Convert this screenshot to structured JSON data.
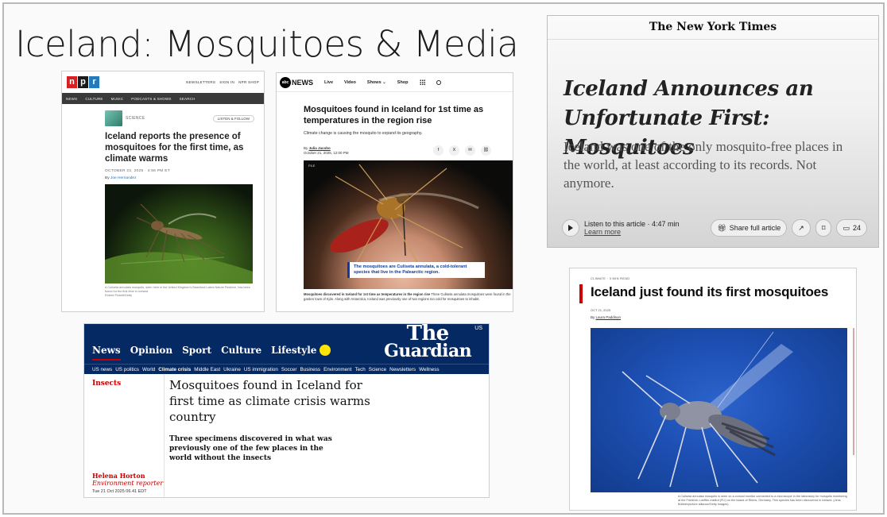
{
  "slide": {
    "title": "Iceland: Mosquitoes & Media"
  },
  "npr": {
    "logo": [
      "n",
      "p",
      "r"
    ],
    "util": [
      "NEWSLETTERS",
      "SIGN IN",
      "NPR SHOP"
    ],
    "nav": [
      "NEWS",
      "CULTURE",
      "MUSIC",
      "PODCASTS & SHOWS",
      "SEARCH"
    ],
    "section": "SCIENCE",
    "listen": "LISTEN & FOLLOW",
    "headline": "Iceland reports the presence of mosquitoes for the first time, as climate warms",
    "date": "OCTOBER 22, 2025 · 4:56 PM ET",
    "by_prefix": "By",
    "author": "Joe Hernandez",
    "caption": "A Culiseta annulata mosquito, seen here in the United Kingdom's Blashford Lakes Nature Reserve, has been found for the first time in Iceland.",
    "credit": "Robert Pickett/Getty"
  },
  "abc": {
    "logo": "abc",
    "logo_word": "NEWS",
    "nav": [
      "Live",
      "Video",
      "Shows",
      "Shop"
    ],
    "headline": "Mosquitoes found in Iceland for 1st time as temperatures in the region rise",
    "dek": "Climate change is causing the mosquito to expand its geography.",
    "by_prefix": "By",
    "author": "Julia Jacobo",
    "date": "October 21, 2025, 12:00 PM",
    "share": [
      "f",
      "X",
      "✉",
      "⛓"
    ],
    "file_tag": "FILE",
    "callout": "The mosquitoes are Culiseta annulata, a cold-tolerant species that live in the Palearctic region.",
    "caption_bold": "Mosquitoes discovered in Iceland for 1st time as temperatures in the region rise",
    "caption": "Three Culiseta annulata mosquitoes were found in the garden town of Kjós. Along with Antarctica, Iceland was previously one of two regions too cold for mosquitoes to inhabit."
  },
  "nyt": {
    "masthead": "The New York Times",
    "headline": "Iceland Announces an Unfortunate First: Mosquitoes",
    "dek": "Iceland was one of the only mosquito-free places in the world, at least according to its records. Not anymore.",
    "listen": "Listen to this article · 4:47 min",
    "learn": "Learn more",
    "share": "Share full article",
    "comments": "24"
  },
  "guardian": {
    "tabs": [
      "News",
      "Opinion",
      "Sport",
      "Culture",
      "Lifestyle"
    ],
    "logo_l1": "The",
    "logo_l2": "Guardian",
    "edition": "US",
    "subnav": [
      "US news",
      "US politics",
      "World",
      "Climate crisis",
      "Middle East",
      "Ukraine",
      "US immigration",
      "Soccer",
      "Business",
      "Environment",
      "Tech",
      "Science",
      "Newsletters",
      "Wellness"
    ],
    "section": "Insects",
    "headline": "Mosquitoes found in Iceland for first time as climate crisis warms country",
    "standfirst": "Three specimens discovered in what was previously one of the few places in the world without the insects",
    "author": "Helena Horton",
    "role": "Environment reporter",
    "date": "Tue 21 Oct 2025 06.41 EDT"
  },
  "cnn": {
    "crumb": "CLIMATE · 3 MIN READ",
    "headline": "Iceland just found its first mosquitoes",
    "date": "OCT 21, 2025",
    "by_prefix": "By",
    "author": "Laura Paddison",
    "caption": "A Culiseta annulata mosquito is seen on a conical monitor connected to a microscope in the laboratory for mosquito monitoring at the Friedrich-Loeffler-Institut (FLI) on the island of Riems, Germany. This species has been discovered in Iceland. (Jens Büttner/picture alliance/Getty Images)"
  },
  "colors": {
    "npr_red": "#d62021",
    "npr_blue": "#237bbd",
    "abc_callout": "#123a9c",
    "guardian_navy": "#052962",
    "guardian_red": "#c70000",
    "guardian_yellow": "#ffe500",
    "cnn_red": "#cc0000"
  }
}
